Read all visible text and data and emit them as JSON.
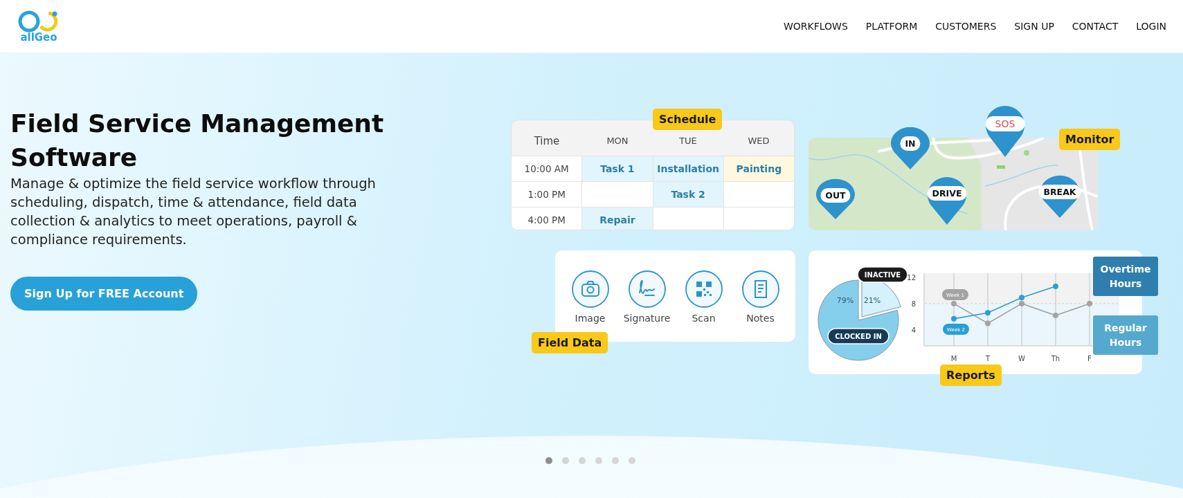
{
  "header": {
    "logo_text": "allGeo",
    "nav": [
      "WORKFLOWS",
      "PLATFORM",
      "CUSTOMERS",
      "SIGN UP",
      "CONTACT",
      "LOGIN"
    ]
  },
  "hero": {
    "title": "Field Service Management Software",
    "description": "Manage & optimize the field service workflow through scheduling, dispatch, time & attendance, field data collection & analytics to meet operations, payroll & compliance requirements.",
    "cta": "Sign Up for FREE Account"
  },
  "schedule": {
    "badge": "Schedule",
    "columns": [
      "Time",
      "MON",
      "TUE",
      "WED"
    ],
    "rows": [
      {
        "cells": [
          {
            "text": "10:00 AM",
            "kind": "time"
          },
          {
            "text": "Task 1",
            "kind": "task",
            "color": "#e2f4fc"
          },
          {
            "text": "Installation",
            "kind": "task",
            "color": "#e2f4fc"
          },
          {
            "text": "Painting",
            "kind": "task",
            "color": "#fdf8df"
          }
        ]
      },
      {
        "cells": [
          {
            "text": "1:00 PM",
            "kind": "time"
          },
          {
            "text": "",
            "kind": "task",
            "color": "#ffffff"
          },
          {
            "text": "Task 2",
            "kind": "task",
            "color": "#e2f4fc"
          },
          {
            "text": "",
            "kind": "task",
            "color": "#ffffff"
          }
        ]
      },
      {
        "cells": [
          {
            "text": "4:00 PM",
            "kind": "time"
          },
          {
            "text": "Repair",
            "kind": "task",
            "color": "#e2f4fc"
          },
          {
            "text": "",
            "kind": "task",
            "color": "#ffffff"
          },
          {
            "text": "",
            "kind": "task",
            "color": "#ffffff"
          }
        ]
      }
    ]
  },
  "monitor": {
    "badge": "Monitor",
    "pins": [
      {
        "label": "IN",
        "alert": false
      },
      {
        "label": "SOS",
        "alert": true
      },
      {
        "label": "OUT",
        "alert": false
      },
      {
        "label": "DRIVE",
        "alert": false
      },
      {
        "label": "BREAK",
        "alert": false
      }
    ]
  },
  "field_data": {
    "badge": "Field Data",
    "items": [
      "Image",
      "Signature",
      "Scan",
      "Notes"
    ]
  },
  "reports": {
    "badge": "Reports",
    "pie": {
      "chart_data": {
        "type": "pie",
        "categories": [
          "CLOCKED IN",
          "INACTIVE"
        ],
        "values": [
          79,
          21
        ],
        "value_labels": [
          "79%",
          "21%"
        ]
      }
    },
    "line": {
      "chart_data": {
        "type": "line",
        "categories": [
          "M",
          "T",
          "W",
          "Th",
          "F"
        ],
        "ylim": [
          1.6,
          12.6
        ],
        "yticks": [
          4,
          8,
          12
        ],
        "grid": true,
        "series": [
          {
            "name": "Week 1",
            "color": "#a3a3a3",
            "marker": "o",
            "values": [
              8,
              5,
              8,
              6.2,
              8
            ]
          },
          {
            "name": "Week 2",
            "color": "#2a9fd6",
            "marker": "o",
            "values": [
              5.7,
              6.6,
              8.9,
              10.6,
              null
            ]
          }
        ]
      }
    },
    "boxes": [
      {
        "text": "Overtime Hours",
        "color": "#2f7fae"
      },
      {
        "text": "Regular Hours",
        "color": "#55a9cf"
      }
    ]
  },
  "carousel": {
    "dots": [
      {
        "selected": true
      },
      {
        "selected": false
      },
      {
        "selected": false
      },
      {
        "selected": false
      },
      {
        "selected": false
      },
      {
        "selected": false
      }
    ]
  }
}
